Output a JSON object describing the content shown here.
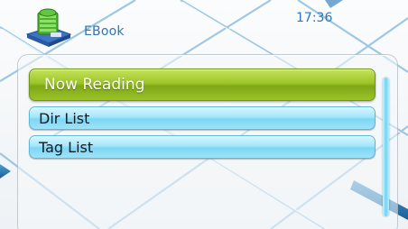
{
  "header": {
    "app_title": "EBook",
    "clock": "17:36",
    "app_icon": "ebook-books-icon"
  },
  "menu": {
    "items": [
      {
        "label": "Now Reading",
        "selected": true
      },
      {
        "label": "Dir List",
        "selected": false
      },
      {
        "label": "Tag List",
        "selected": false
      }
    ]
  },
  "colors": {
    "accent_blue": "#2a76b8",
    "selected_green": "#9cc527",
    "item_cyan": "#a4e6fb"
  }
}
